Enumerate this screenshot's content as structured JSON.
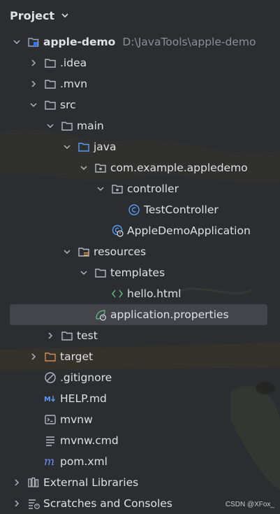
{
  "panel": {
    "title": "Project"
  },
  "tree": {
    "root": {
      "name": "apple-demo",
      "path": "D:\\JavaTools\\apple-demo"
    },
    "idea": ".idea",
    "mvn": ".mvn",
    "src": "src",
    "main": "main",
    "java": "java",
    "pkg": "com.example.appledemo",
    "controller": "controller",
    "test_controller": "TestController",
    "app_class": "AppleDemoApplication",
    "resources": "resources",
    "templates": "templates",
    "hello": "hello.html",
    "app_props": "application.properties",
    "test": "test",
    "target": "target",
    "gitignore": ".gitignore",
    "help": "HELP.md",
    "mvnw": "mvnw",
    "mvnw_cmd": "mvnw.cmd",
    "pom": "pom.xml",
    "ext_libs": "External Libraries",
    "scratches": "Scratches and Consoles"
  },
  "watermark": "CSDN @XFox_",
  "colors": {
    "background": "#2b2d30",
    "text": "#dfe1e5",
    "folder_excluded": "#d08a5a",
    "selection": "#43454a",
    "class_icon": "#5a9cf8",
    "html_icon": "#5fb57c"
  }
}
